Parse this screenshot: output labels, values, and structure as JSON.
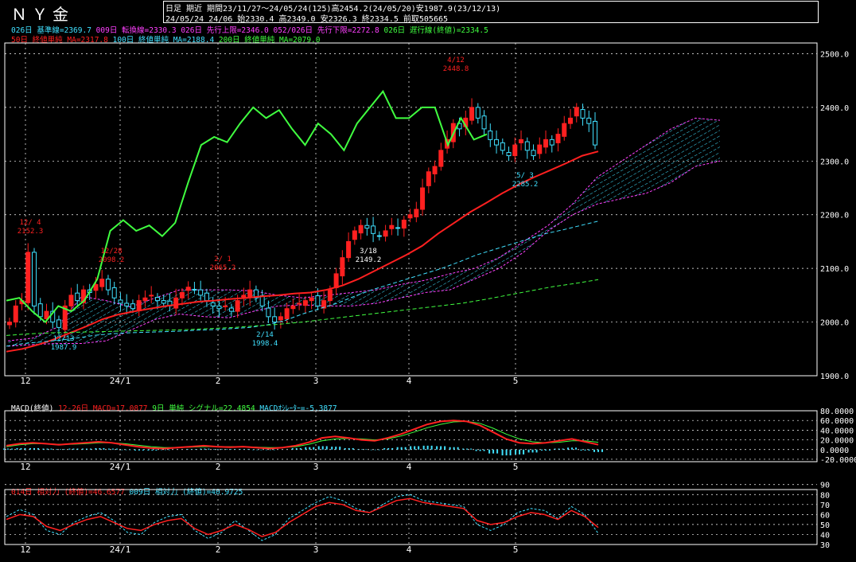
{
  "header": {
    "title": "ＮＹ金",
    "info_line1": "日足 期近 期間23/11/27～24/05/24(125)高2454.2(24/05/20)安1987.9(23/12/13)",
    "info_line2": "24/05/24 24/06 始2330.4 高2349.0 安2326.3 終2334.5 前取505665"
  },
  "legend_main_row1": [
    {
      "text": "026日 基準線=2369.7",
      "color": "#40e0ff"
    },
    {
      "text": "009日 転換線=2330.3",
      "color": "#ff40ff"
    },
    {
      "text": "026日 先行上限=2346.0",
      "color": "#ff40ff"
    },
    {
      "text": "052/026日 先行下限=2272.8",
      "color": "#ff40ff"
    },
    {
      "text": "026日 遅行線(終値)=2334.5",
      "color": "#40ff40"
    }
  ],
  "legend_main_row2": [
    {
      "text": "50日 終値単純 MA=2317.8",
      "color": "#ff2020"
    },
    {
      "text": "100日 終値単純 MA=2188.4",
      "color": "#40e0ff"
    },
    {
      "text": "200日 終値単純 MA=2079.0",
      "color": "#40ff40"
    }
  ],
  "legend_macd": [
    {
      "text": "MACD(終値)",
      "color": "#ffffff"
    },
    {
      "text": "12-26日 MACD=17.0877",
      "color": "#ff2020"
    },
    {
      "text": "9日 単純 シグナル=22.4854",
      "color": "#40ff40"
    },
    {
      "text": "MACDｵｼﾚｰﾀｰ=-5.3877",
      "color": "#40e0ff"
    }
  ],
  "legend_rsi": [
    {
      "text": "014日 相対力 (終値)=46.6577",
      "color": "#ff2020"
    },
    {
      "text": "009日 相対力 (終値)=40.9725",
      "color": "#40e0ff"
    }
  ],
  "x_axis_labels": [
    "12",
    "24/1",
    "2",
    "3",
    "4",
    "5"
  ],
  "colors": {
    "up": "#ff2020",
    "down": "#40e0ff",
    "ma50": "#ff2020",
    "ma100": "#40e0ff",
    "ma200": "#40ff40",
    "chikou": "#40ff40",
    "kumo": "#ff40ff",
    "grid": "#ffffff"
  },
  "chart_data": [
    {
      "type": "line",
      "title": "ＮＹ金 日足",
      "ylim": [
        1900,
        2520
      ],
      "yticks": [
        "2500.0",
        "2400.0",
        "2300.0",
        "2200.0",
        "2100.0",
        "2000.0",
        "1900.0"
      ],
      "x_labels": [
        "12",
        "24/1",
        "2",
        "3",
        "4",
        "5"
      ],
      "annotations": [
        {
          "text": "12/ 4",
          "value": "2152.3",
          "color": "#ff2020"
        },
        {
          "text": "12/13",
          "value": "1987.9",
          "color": "#40e0ff"
        },
        {
          "text": "12/28",
          "value": "2098.2",
          "color": "#ff2020"
        },
        {
          "text": "2/ 1",
          "value": "2065.2",
          "color": "#ff2020"
        },
        {
          "text": "2/14",
          "value": "1998.4",
          "color": "#40e0ff"
        },
        {
          "text": "3/18",
          "value": "2149.2",
          "color": "#ffffff"
        },
        {
          "text": "4/12",
          "value": "2448.8",
          "color": "#ff2020"
        },
        {
          "text": "5/ 3",
          "value": "2285.2",
          "color": "#40e0ff"
        }
      ],
      "series": [
        {
          "name": "50日 終値単純 MA",
          "values": [
            1945,
            1950,
            1958,
            1968,
            1980,
            1992,
            2005,
            2014,
            2020,
            2025,
            2030,
            2034,
            2038,
            2040,
            2043,
            2045,
            2048,
            2050,
            2053,
            2055,
            2060,
            2068,
            2080,
            2095,
            2110,
            2125,
            2142,
            2165,
            2185,
            2205,
            2222,
            2240,
            2256,
            2270,
            2283,
            2296,
            2310,
            2318
          ]
        },
        {
          "name": "100日 終値単純 MA",
          "values": [
            1955,
            1960,
            1963,
            1966,
            1970,
            1975,
            1978,
            1980,
            1981,
            1982,
            1983,
            1985,
            1986,
            1988,
            1990,
            1995,
            2003,
            2015,
            2025,
            2035,
            2048,
            2060,
            2070,
            2080,
            2090,
            2100,
            2112,
            2125,
            2135,
            2145,
            2155,
            2165,
            2172,
            2180,
            2188
          ]
        },
        {
          "name": "200日 終値単純 MA",
          "values": [
            1975,
            1978,
            1980,
            1981,
            1982,
            1983,
            1984,
            1985,
            1986,
            1988,
            1990,
            1993,
            1996,
            2000,
            2005,
            2010,
            2015,
            2020,
            2025,
            2030,
            2035,
            2042,
            2050,
            2058,
            2066,
            2072,
            2079
          ]
        }
      ]
    },
    {
      "type": "line",
      "title": "MACD(終値)",
      "ylim": [
        -25,
        80
      ],
      "yticks": [
        "80.0000",
        "60.0000",
        "40.0000",
        "20.0000",
        "0.0000",
        "-20.0000"
      ],
      "series": [
        {
          "name": "MACD",
          "values": [
            8,
            12,
            14,
            12,
            10,
            12,
            14,
            16,
            14,
            10,
            6,
            3,
            2,
            4,
            6,
            8,
            6,
            5,
            6,
            4,
            2,
            4,
            8,
            15,
            24,
            27,
            24,
            20,
            18,
            24,
            32,
            42,
            52,
            58,
            60,
            58,
            50,
            36,
            22,
            14,
            12,
            14,
            18,
            22,
            16,
            10
          ]
        },
        {
          "name": "シグナル",
          "values": [
            6,
            10,
            12,
            12,
            11,
            11,
            12,
            14,
            14,
            12,
            9,
            6,
            4,
            4,
            5,
            6,
            6,
            6,
            6,
            5,
            4,
            4,
            6,
            11,
            18,
            22,
            23,
            22,
            20,
            22,
            28,
            36,
            45,
            52,
            57,
            58,
            54,
            44,
            32,
            22,
            16,
            14,
            15,
            18,
            18,
            15
          ]
        }
      ],
      "histogram": [
        2,
        3,
        3,
        2,
        1,
        2,
        2,
        3,
        2,
        -1,
        -2,
        -2,
        -1,
        0,
        1,
        2,
        1,
        1,
        1,
        -1,
        -1,
        0,
        3,
        5,
        7,
        6,
        3,
        1,
        -1,
        3,
        5,
        7,
        8,
        7,
        5,
        2,
        -3,
        -8,
        -12,
        -10,
        -6,
        -2,
        2,
        4,
        -2,
        -5
      ]
    },
    {
      "type": "line",
      "title": "相対力 RSI",
      "ylim": [
        30,
        85
      ],
      "yticks": [
        "90",
        "80",
        "70",
        "60",
        "50",
        "40",
        "30"
      ],
      "series": [
        {
          "name": "014日 相対力",
          "values": [
            55,
            60,
            58,
            48,
            44,
            50,
            55,
            58,
            52,
            46,
            44,
            50,
            54,
            56,
            46,
            40,
            44,
            50,
            45,
            38,
            42,
            52,
            60,
            68,
            72,
            70,
            64,
            62,
            68,
            74,
            76,
            72,
            70,
            68,
            66,
            54,
            50,
            52,
            58,
            62,
            60,
            55,
            64,
            58,
            47
          ]
        },
        {
          "name": "009日 相対力",
          "values": [
            58,
            65,
            60,
            44,
            40,
            52,
            58,
            62,
            54,
            42,
            40,
            52,
            58,
            60,
            44,
            36,
            42,
            54,
            44,
            34,
            40,
            56,
            64,
            72,
            78,
            74,
            66,
            62,
            70,
            78,
            80,
            74,
            72,
            70,
            68,
            50,
            44,
            50,
            62,
            66,
            64,
            56,
            68,
            60,
            41
          ]
        }
      ]
    }
  ]
}
